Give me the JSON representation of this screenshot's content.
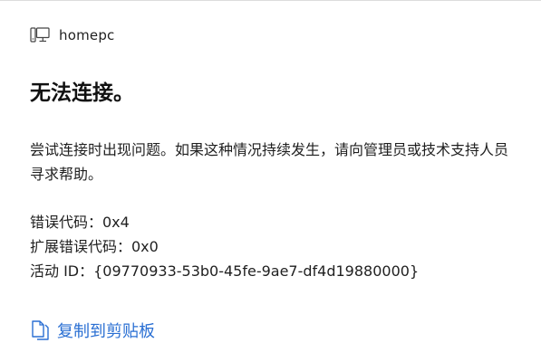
{
  "host": {
    "icon": "computer-monitor-icon",
    "name": "homepc"
  },
  "dialog": {
    "title": "无法连接。",
    "message": "尝试连接时出现问题。如果这种情况持续发生，请向管理员或技术支持人员寻求帮助。",
    "error_code": "错误代码：0x4",
    "extended_error_code": "扩展错误代码：0x0",
    "activity_id": "活动 ID：{09770933-53b0-45fe-9ae7-df4d19880000}"
  },
  "copy": {
    "icon": "copy-icon",
    "label": "复制到剪贴板",
    "color": "#2a6fd3"
  }
}
